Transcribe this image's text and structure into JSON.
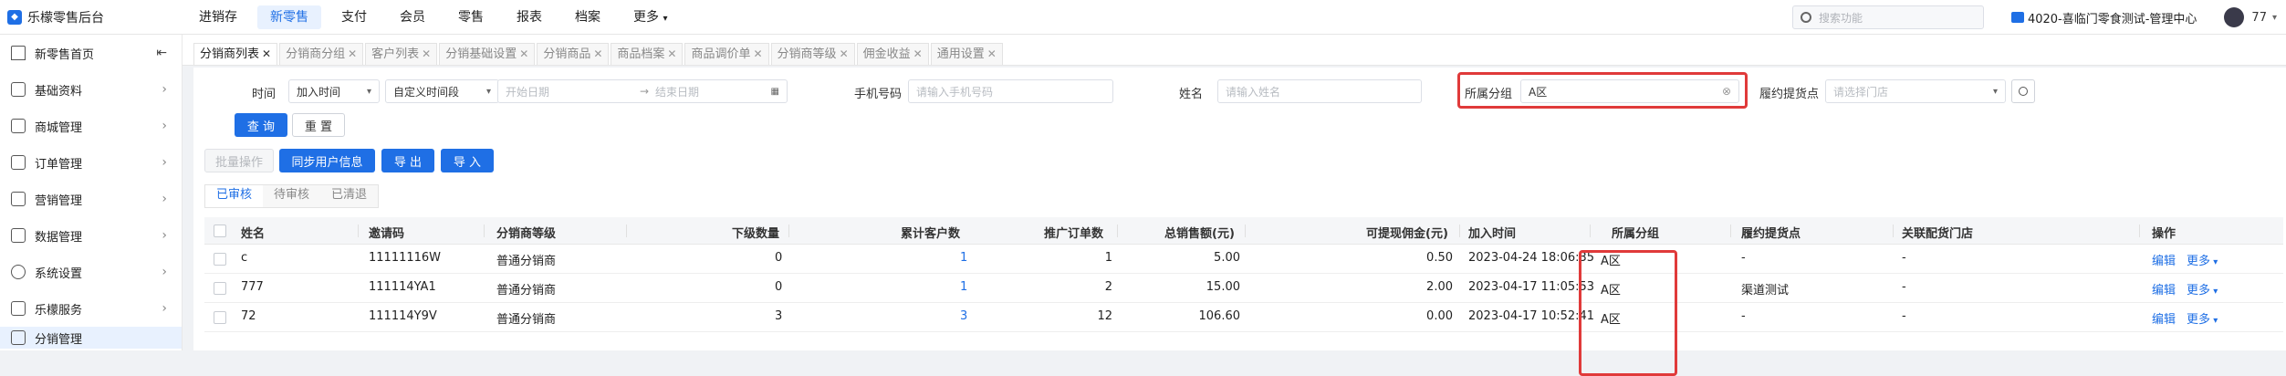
{
  "app": {
    "title": "乐檬零售后台"
  },
  "topnav": [
    "进销存",
    "新零售",
    "支付",
    "会员",
    "零售",
    "报表",
    "档案",
    "更多"
  ],
  "topnav_active": 1,
  "search": {
    "placeholder": "搜索功能"
  },
  "store": {
    "name": "4020-喜临门零食测试-管理中心"
  },
  "user": {
    "name": "77"
  },
  "sidebar": {
    "home": "新零售首页",
    "items": [
      "基础资料",
      "商城管理",
      "订单管理",
      "营销管理",
      "数据管理",
      "系统设置",
      "乐檬服务",
      "分销管理"
    ]
  },
  "tabs": [
    "分销商列表",
    "分销商分组",
    "客户列表",
    "分销基础设置",
    "分销商品",
    "商品档案",
    "商品调价单",
    "分销商等级",
    "佣金收益",
    "通用设置"
  ],
  "filters": {
    "time_label": "时间",
    "time_type": "加入时间",
    "time_range": "自定义时间段",
    "start_placeholder": "开始日期",
    "end_placeholder": "结束日期",
    "range_arrow": "→",
    "phone_label": "手机号码",
    "phone_placeholder": "请输入手机号码",
    "name_label": "姓名",
    "name_placeholder": "请输入姓名",
    "group_label": "所属分组",
    "group_value": "A区",
    "pickup_label": "履约提货点",
    "pickup_placeholder": "请选择门店",
    "query_btn": "查 询",
    "reset_btn": "重 置"
  },
  "actions": {
    "batch": "批量操作",
    "sync": "同步用户信息",
    "export": "导 出",
    "import": "导 入"
  },
  "subtabs": [
    "已审核",
    "待审核",
    "已清退"
  ],
  "table": {
    "headers": [
      "姓名",
      "邀请码",
      "分销商等级",
      "下级数量",
      "累计客户数",
      "推广订单数",
      "总销售额(元)",
      "可提现佣金(元)",
      "加入时间",
      "所属分组",
      "履约提货点",
      "关联配货门店",
      "操作"
    ],
    "rows": [
      {
        "name": "c",
        "code": "11111116W",
        "level": "普通分销商",
        "sub": "0",
        "customers": "1",
        "orders": "1",
        "sales": "5.00",
        "commission": "0.50",
        "time": "2023-04-24 18:06:35",
        "group": "A区",
        "pickup": "-",
        "store": "-",
        "edit": "编辑",
        "more": "更多"
      },
      {
        "name": "777",
        "code": "111114YA1",
        "level": "普通分销商",
        "sub": "0",
        "customers": "1",
        "orders": "2",
        "sales": "15.00",
        "commission": "2.00",
        "time": "2023-04-17 11:05:53",
        "group": "A区",
        "pickup": "渠道测试",
        "store": "-",
        "edit": "编辑",
        "more": "更多"
      },
      {
        "name": "72",
        "code": "111114Y9V",
        "level": "普通分销商",
        "sub": "3",
        "customers": "3",
        "orders": "12",
        "sales": "106.60",
        "commission": "0.00",
        "time": "2023-04-17 10:52:41",
        "group": "A区",
        "pickup": "-",
        "store": "-",
        "edit": "编辑",
        "more": "更多"
      }
    ]
  },
  "colors": {
    "primary": "#1f6fe5",
    "highlight": "#e03a3a"
  }
}
